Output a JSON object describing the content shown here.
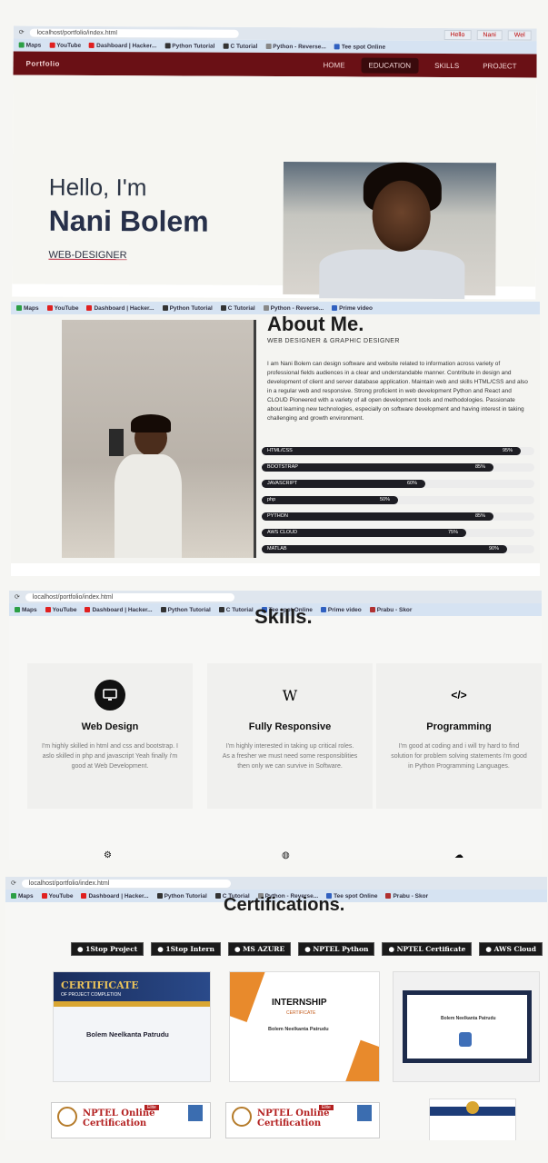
{
  "browser": {
    "url": "localhost/portfolio/index.html",
    "tabs": [
      "Hello",
      "Nani",
      "Wel"
    ],
    "bookmarks": [
      "Maps",
      "YouTube",
      "Dashboard | Hacker...",
      "Python Tutorial",
      "C Tutorial",
      "Python - Reverse...",
      "Tee spot Online",
      "Prime video",
      "Prabu - Skor"
    ]
  },
  "colors": {
    "nav": "#6a1015",
    "bar": "#1e1e24",
    "accent": "#c0223a"
  },
  "hero": {
    "brand": "Portfolio",
    "nav": [
      "HOME",
      "EDUCATION",
      "SKILLS",
      "PROJECT"
    ],
    "greeting": "Hello, I'm",
    "name": "Nani Bolem",
    "role": "WEB-DESIGNER"
  },
  "about": {
    "title": "About Me.",
    "subtitle": "WEB DESIGNER & GRAPHIC DESIGNER",
    "paragraph_name": "Nani Bolem",
    "paragraph": "I am Nani Bolem can design software and website related to information across variety of professional fields audiences in a clear and understandable manner. Contribute in design and development of client and server database application. Maintain web and skills HTML/CSS and also in a regular web and responsive. Strong proficient in web development Python and React and CLOUD Pioneered with a variety of all open development tools and methodologies. Passionate about learning new technologies, especially on software development and having interest in taking challenging and growth environment.",
    "skills": [
      {
        "name": "HTML/CSS",
        "percent": 95
      },
      {
        "name": "BOOTSTRAP",
        "percent": 85
      },
      {
        "name": "JAVASCRIPT",
        "percent": 60
      },
      {
        "name": "php",
        "percent": 50
      },
      {
        "name": "PYTHON",
        "percent": 85
      },
      {
        "name": "AWS CLOUD",
        "percent": 75
      },
      {
        "name": "MATLAB",
        "percent": 90
      }
    ]
  },
  "services": {
    "title": "Skills.",
    "cards": [
      {
        "icon": "monitor-icon",
        "title": "Web Design",
        "text": "I'm highly skilled in html and css and bootstrap. I aslo skilled in php and javascript Yeah finally i'm good at Web Development."
      },
      {
        "icon": "wikipedia-icon",
        "title": "Fully Responsive",
        "text": "I'm highly interested in taking up critical roles. As a fresher we must need some responsiblities then only we can survive in Software."
      },
      {
        "icon": "code-icon",
        "title": "Programming",
        "text": "I'm good at coding and i will try hard to find solution for problem solving statements i'm good in Python Programming Languages."
      }
    ]
  },
  "certifications": {
    "title": "Certifications.",
    "filters": [
      "1Stop Project",
      "1Stop Intern",
      "MS AZURE",
      "NPTEL Python",
      "NPTEL Certificate",
      "AWS Cloud"
    ],
    "cards": [
      {
        "heading": "CERTIFICATE",
        "sub": "OF PROJECT COMPLETION",
        "name": "Bolem Neelkanta Patrudu"
      },
      {
        "heading": "INTERNSHIP",
        "sub": "CERTIFICATE",
        "name": "Bolem Neelkanta Patrudu"
      },
      {
        "heading": "",
        "sub": "",
        "name": "Bolem Neelkanta Patrudu"
      }
    ],
    "nptel": [
      "NPTEL Online Certification",
      "NPTEL Online Certification"
    ],
    "nptel_badge": "Elite"
  }
}
